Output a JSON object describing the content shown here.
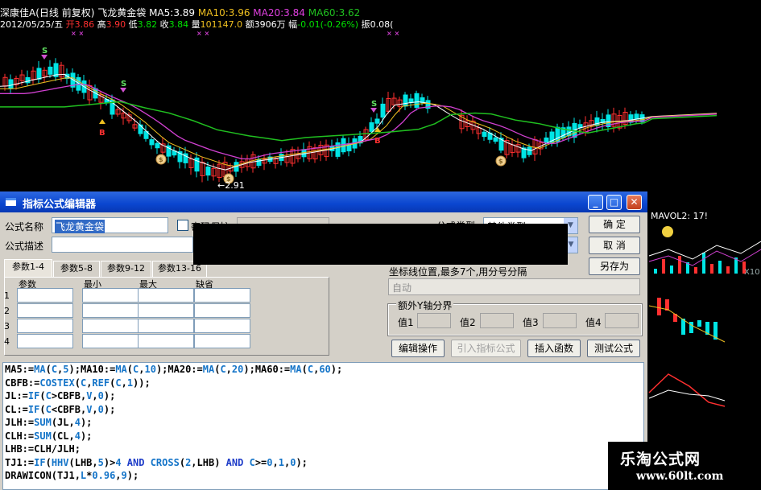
{
  "chart_header": {
    "stock": "深康佳A",
    "mode": "(日线 前复权)",
    "formula": "飞龙黄金袋",
    "ma5_label": "MA5:",
    "ma5": "3.89",
    "ma10_label": "MA10:",
    "ma10": "3.96",
    "ma20_label": "MA20:",
    "ma20": "3.84",
    "ma60_label": "MA60:",
    "ma60": "3.62",
    "date": "2012/05/25/五",
    "open_label": "开",
    "open": "3.86",
    "high_label": "高",
    "high": "3.90",
    "low_label": "低",
    "low": "3.82",
    "close_label": "收",
    "close": "3.84",
    "vol_label": "量",
    "vol": "101147.0",
    "amount_label": "额",
    "amount": "3906万",
    "change_label": "幅",
    "change": "-0.01(-0.26%)",
    "amp_label": "振",
    "amp": "0.08("
  },
  "chart_marks": {
    "sell": "S",
    "buy": "B",
    "bag": "$",
    "low_value": "2.91"
  },
  "side_panel": {
    "mavol": "MAVOL2: 17!",
    "x10": "X10"
  },
  "colors": {
    "up": "#ff3030",
    "down": "#00e5e5",
    "ma5": "#ffffff",
    "ma10": "#f0c020",
    "ma20": "#d040d0",
    "ma60": "#20c020"
  },
  "dialog": {
    "title": "指标公式编辑器",
    "name_label": "公式名称",
    "name_value": "飞龙黄金袋",
    "desc_label": "公式描述",
    "desc_value": "",
    "password_label": "密码保护",
    "type_label": "公式类型",
    "type_value": "其他类型",
    "ok_button": "确 定",
    "cancel_button": "取 消",
    "saveas_button": "另存为",
    "tabs": [
      "参数1-4",
      "参数5-8",
      "参数9-12",
      "参数13-16"
    ],
    "param_headers": [
      "参数",
      "最小",
      "最大",
      "缺省"
    ],
    "param_rows": [
      "1",
      "2",
      "3",
      "4"
    ],
    "axis_hint": "坐标线位置,最多7个,用分号分隔",
    "axis_value": "自动",
    "extra_y_label": "额外Y轴分界",
    "val_labels": [
      "值1",
      "值2",
      "值3",
      "值4"
    ],
    "edit_button": "编辑操作",
    "import_button": "引入指标公式",
    "insert_button": "插入函数",
    "test_button": "测试公式"
  },
  "code_lines": [
    [
      [
        "k",
        "MA5:="
      ],
      [
        "f",
        "MA"
      ],
      [
        "p",
        "("
      ],
      [
        "n",
        "C"
      ],
      [
        "p",
        ","
      ],
      [
        "n",
        "5"
      ],
      [
        "p",
        ");"
      ],
      [
        "k",
        "MA10:="
      ],
      [
        "f",
        "MA"
      ],
      [
        "p",
        "("
      ],
      [
        "n",
        "C"
      ],
      [
        "p",
        ","
      ],
      [
        "n",
        "10"
      ],
      [
        "p",
        ");"
      ],
      [
        "k",
        "MA20:="
      ],
      [
        "f",
        "MA"
      ],
      [
        "p",
        "("
      ],
      [
        "n",
        "C"
      ],
      [
        "p",
        ","
      ],
      [
        "n",
        "20"
      ],
      [
        "p",
        ");"
      ],
      [
        "k",
        "MA60:="
      ],
      [
        "f",
        "MA"
      ],
      [
        "p",
        "("
      ],
      [
        "n",
        "C"
      ],
      [
        "p",
        ","
      ],
      [
        "n",
        "60"
      ],
      [
        "p",
        ");"
      ]
    ],
    [
      [
        "k",
        "CBFB:="
      ],
      [
        "f",
        "COSTEX"
      ],
      [
        "p",
        "("
      ],
      [
        "n",
        "C"
      ],
      [
        "p",
        ","
      ],
      [
        "f",
        "REF"
      ],
      [
        "p",
        "("
      ],
      [
        "n",
        "C"
      ],
      [
        "p",
        ","
      ],
      [
        "n",
        "1"
      ],
      [
        "p",
        "));"
      ]
    ],
    [
      [
        "k",
        "JL:="
      ],
      [
        "f",
        "IF"
      ],
      [
        "p",
        "("
      ],
      [
        "n",
        "C"
      ],
      [
        "p",
        ">CBFB,"
      ],
      [
        "n",
        "V"
      ],
      [
        "p",
        ","
      ],
      [
        "n",
        "0"
      ],
      [
        "p",
        ");"
      ]
    ],
    [
      [
        "k",
        "CL:="
      ],
      [
        "f",
        "IF"
      ],
      [
        "p",
        "("
      ],
      [
        "n",
        "C"
      ],
      [
        "p",
        "<CBFB,"
      ],
      [
        "n",
        "V"
      ],
      [
        "p",
        ","
      ],
      [
        "n",
        "0"
      ],
      [
        "p",
        ");"
      ]
    ],
    [
      [
        "k",
        "JLH:="
      ],
      [
        "f",
        "SUM"
      ],
      [
        "p",
        "(JL,"
      ],
      [
        "n",
        "4"
      ],
      [
        "p",
        ");"
      ]
    ],
    [
      [
        "k",
        "CLH:="
      ],
      [
        "f",
        "SUM"
      ],
      [
        "p",
        "(CL,"
      ],
      [
        "n",
        "4"
      ],
      [
        "p",
        ");"
      ]
    ],
    [
      [
        "k",
        "LHB:=CLH/JLH;"
      ]
    ],
    [
      [
        "k",
        "TJ1:="
      ],
      [
        "f",
        "IF"
      ],
      [
        "p",
        "("
      ],
      [
        "f",
        "HHV"
      ],
      [
        "p",
        "(LHB,"
      ],
      [
        "n",
        "5"
      ],
      [
        "p",
        ")>"
      ],
      [
        "n",
        "4"
      ],
      [
        "p",
        " "
      ],
      [
        "bl",
        "AND"
      ],
      [
        "p",
        " "
      ],
      [
        "f",
        "CROSS"
      ],
      [
        "p",
        "("
      ],
      [
        "n",
        "2"
      ],
      [
        "p",
        ",LHB) "
      ],
      [
        "bl",
        "AND"
      ],
      [
        "p",
        " "
      ],
      [
        "n",
        "C"
      ],
      [
        "p",
        ">="
      ],
      [
        "n",
        "0"
      ],
      [
        "p",
        ","
      ],
      [
        "n",
        "1"
      ],
      [
        "p",
        ","
      ],
      [
        "n",
        "0"
      ],
      [
        "p",
        ");"
      ]
    ],
    [
      [
        "k",
        "DRAWICON"
      ],
      [
        "p",
        "(TJ1,"
      ],
      [
        "n",
        "L"
      ],
      [
        "p",
        "*"
      ],
      [
        "n",
        "0.96"
      ],
      [
        "p",
        ","
      ],
      [
        "n",
        "9"
      ],
      [
        "p",
        ");"
      ]
    ]
  ],
  "watermark": {
    "line1": "乐淘公式网",
    "line2": "www.60lt.com"
  }
}
